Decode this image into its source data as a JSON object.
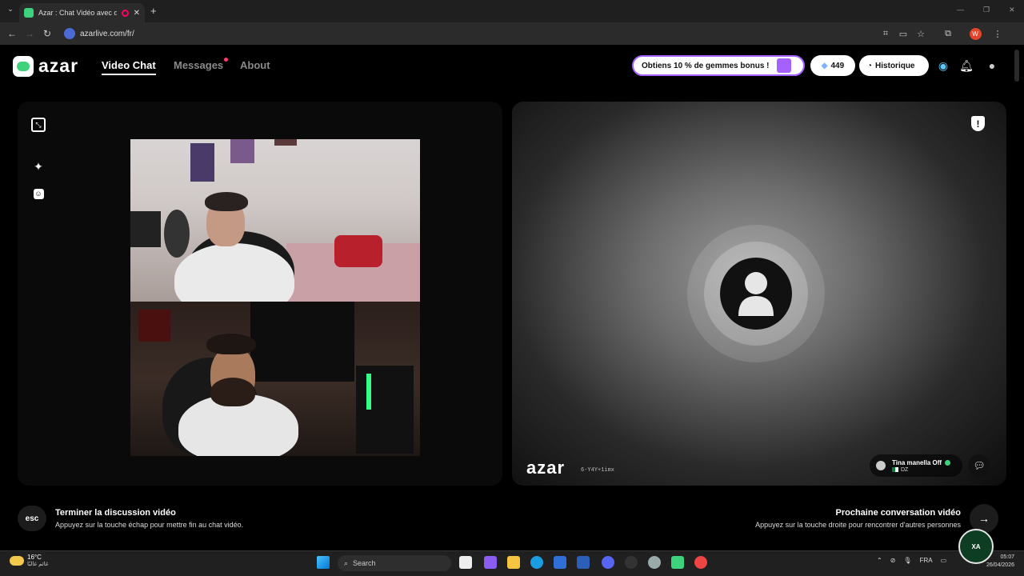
{
  "browser": {
    "tab_title": "Azar : Chat Vidéo avec de n",
    "url": "azarlive.com/fr/",
    "profile_initial": "W"
  },
  "header": {
    "logo_text": "azar",
    "nav": {
      "video_chat": "Video Chat",
      "messages": "Messages",
      "about": "About"
    },
    "promo_label": "Obtiens 10 % de gemmes bonus !",
    "gems_count": "449",
    "history_label": "Historique"
  },
  "left_panel": {
    "tools": [
      "expand-icon",
      "magic-wand-icon",
      "face-filter-icon"
    ]
  },
  "right_panel": {
    "watermark": "azar",
    "watermark_code": "6-Y4Y+1imx",
    "peer": {
      "name": "Tina manella Off",
      "country": "DZ"
    }
  },
  "actions": {
    "esc_label": "esc",
    "end_title": "Terminer la discussion vidéo",
    "end_subtitle": "Appuyez sur la touche échap pour mettre fin au chat vidéo.",
    "next_title": "Prochaine conversation vidéo",
    "next_subtitle": "Appuyez sur la touche droite pour rencontrer d'autres personnes"
  },
  "taskbar": {
    "temperature": "16°C",
    "weather_text": "غائم غالبًا",
    "search_placeholder": "Search",
    "language": "FRA",
    "time": "05:07",
    "date": "26/04/2026"
  },
  "colors": {
    "brand_green": "#3ed27c",
    "promo_purple": "#a561ff",
    "notification_dot": "#ff3b6b"
  }
}
